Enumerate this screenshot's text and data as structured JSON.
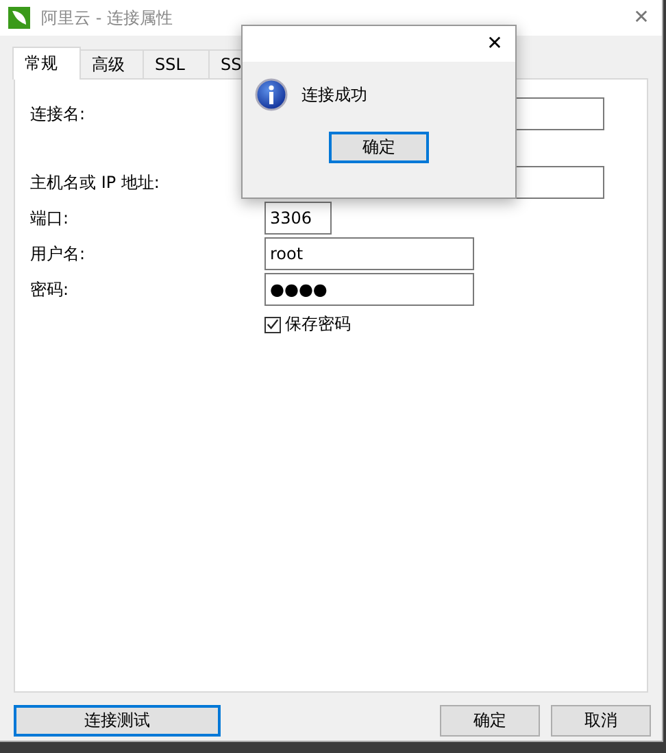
{
  "window": {
    "title": "阿里云 - 连接属性",
    "close": "✕"
  },
  "tabs": [
    {
      "label": "常规",
      "selected": true
    },
    {
      "label": "高级",
      "selected": false
    },
    {
      "label": "SSL",
      "selected": false
    },
    {
      "label": "SS",
      "selected": false
    }
  ],
  "form": {
    "fields": [
      {
        "label": "连接名:"
      },
      {
        "label": "主机名或 IP 地址:"
      },
      {
        "label": "端口:",
        "value": "3306"
      },
      {
        "label": "用户名:",
        "value": "root"
      },
      {
        "label": "密码:",
        "value": "●●●●"
      }
    ],
    "save_password": {
      "label": "保存密码",
      "checked": true
    }
  },
  "buttons": {
    "test": "连接测试",
    "ok": "确定",
    "cancel": "取消"
  },
  "dialog": {
    "close": "✕",
    "message": "连接成功",
    "button": "确定"
  }
}
